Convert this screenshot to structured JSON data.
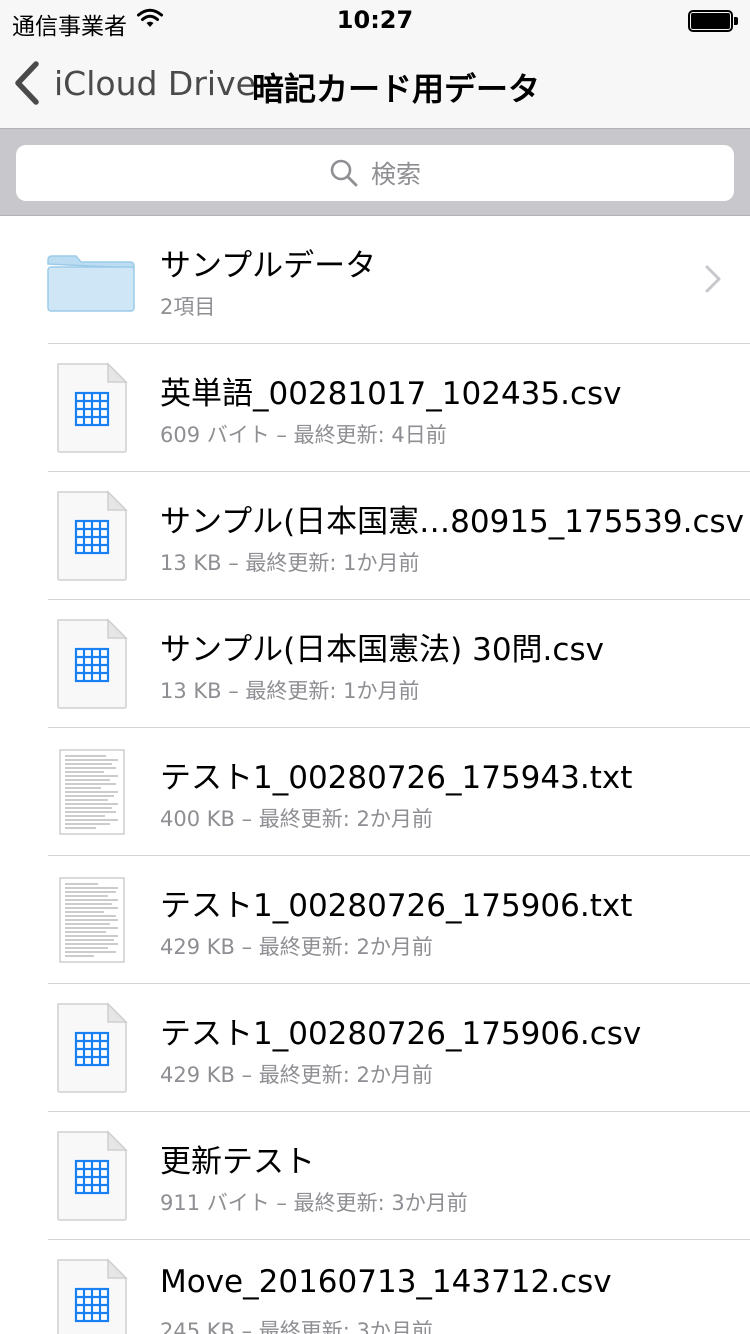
{
  "status_bar": {
    "carrier": "通信事業者",
    "time": "10:27"
  },
  "nav": {
    "back_label": "iCloud Drive",
    "title": "暗記カード用データ"
  },
  "search": {
    "placeholder": "検索"
  },
  "items": [
    {
      "name": "サンプルデータ",
      "meta": "2項目",
      "icon": "folder-icon",
      "kind": "folder"
    },
    {
      "name": "英単語_00281017_102435.csv",
      "meta": "609 バイト – 最終更新: 4日前",
      "icon": "spreadsheet-file-icon",
      "kind": "csv"
    },
    {
      "name": "サンプル(日本国憲…80915_175539.csv",
      "meta": "13 KB – 最終更新: 1か月前",
      "icon": "spreadsheet-file-icon",
      "kind": "csv"
    },
    {
      "name": "サンプル(日本国憲法) 30問.csv",
      "meta": "13 KB – 最終更新: 1か月前",
      "icon": "spreadsheet-file-icon",
      "kind": "csv"
    },
    {
      "name": "テスト1_00280726_175943.txt",
      "meta": "400 KB – 最終更新: 2か月前",
      "icon": "text-file-thumbnail-icon",
      "kind": "txt"
    },
    {
      "name": "テスト1_00280726_175906.txt",
      "meta": "429 KB – 最終更新: 2か月前",
      "icon": "text-file-thumbnail-icon",
      "kind": "txt"
    },
    {
      "name": "テスト1_00280726_175906.csv",
      "meta": "429 KB – 最終更新: 2か月前",
      "icon": "spreadsheet-file-icon",
      "kind": "csv"
    },
    {
      "name": "更新テスト",
      "meta": "911 バイト – 最終更新: 3か月前",
      "icon": "spreadsheet-file-icon",
      "kind": "csv"
    },
    {
      "name": "Move_20160713_143712.csv",
      "meta": "245 KB – 最終更新: 3か月前",
      "icon": "spreadsheet-file-icon",
      "kind": "csv"
    }
  ],
  "colors": {
    "accent_blue": "#1a7ff2",
    "folder_fill": "#cfe6f6",
    "folder_stroke": "#9ccbe8",
    "secondary_text": "#8e8e93"
  }
}
